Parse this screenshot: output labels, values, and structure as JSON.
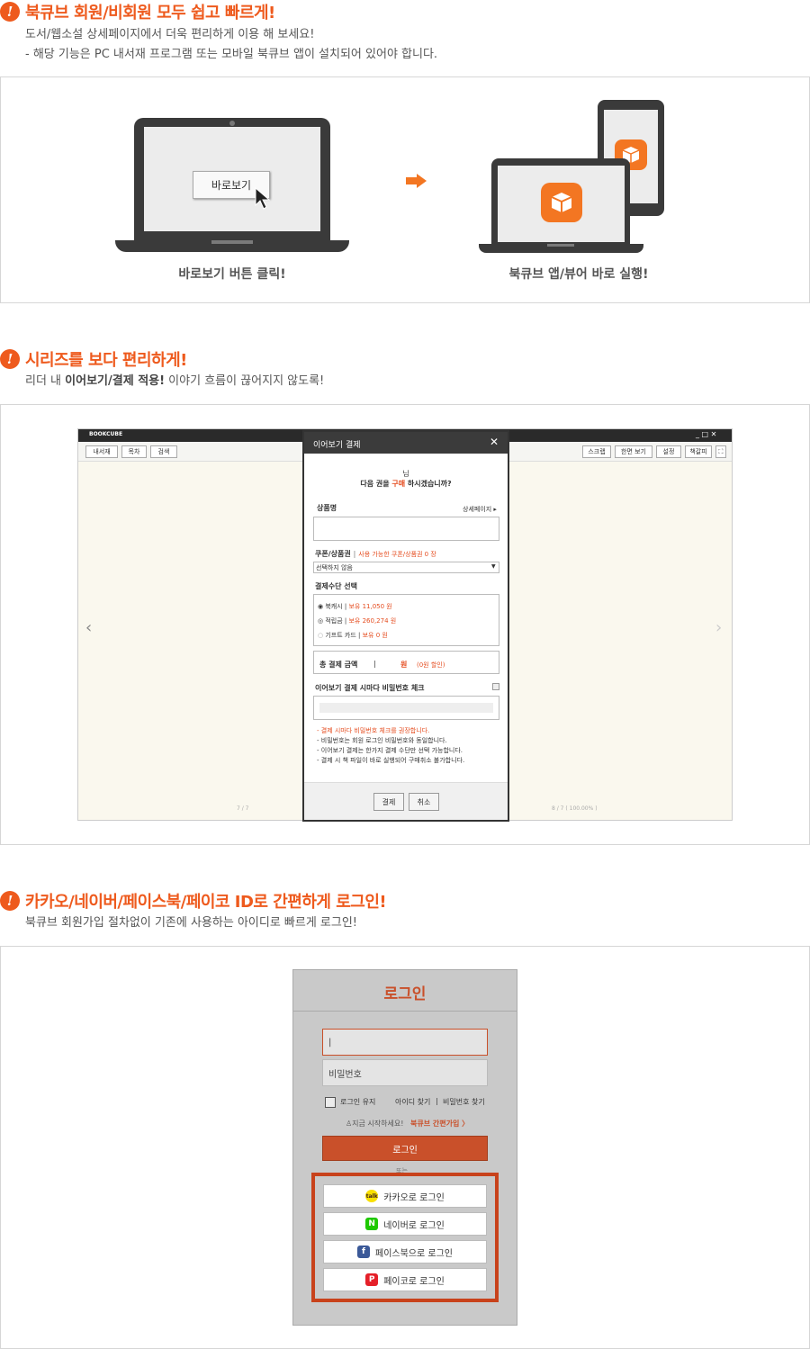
{
  "section1": {
    "title": "북큐브 회원/비회원 모두 쉽고 빠르게!",
    "desc1": "도서/웹소설 상세페이지에서 더욱 편리하게 이용 해 보세요!",
    "desc2": "- 해당 기능은 PC 내서재 프로그램 또는 모바일 북큐브 앱이 설치되어 있어야 합니다.",
    "button_label": "바로보기",
    "caption_left": "바로보기 버튼 클릭!",
    "caption_right": "북큐브 앱/뷰어 바로 실행!"
  },
  "section2": {
    "title": "시리즈를 보다 편리하게!",
    "desc_pre": "리더 내 ",
    "desc_bold": "이어보기/결제 적용!",
    "desc_post": " 이야기 흐름이 끊어지지 않도록!",
    "reader": {
      "logo": "BOOKCUBE",
      "win_controls": "_ □ ✕",
      "left_tools": [
        "내서재",
        "목차",
        "검색"
      ],
      "right_tools": [
        "스크랩",
        "한면 보기",
        "설정",
        "책갈피"
      ],
      "page_left": "7 / 7",
      "page_right": "8 / 7 ( 100.00% )"
    },
    "dialog": {
      "title": "이어보기 결제",
      "close": "✕",
      "line1": "님",
      "line2_pre": "다음 권을 ",
      "line2_red": "구매",
      "line2_post": " 하시겠습니까?",
      "product_label": "상품명",
      "detail_link": "상세페이지 ▸",
      "coupon_label": "쿠폰/상품권",
      "coupon_info": "사용 가능한 쿠폰/상품권 0 장",
      "coupon_select": "선택하지 않음",
      "pay_label": "결제수단 선택",
      "pay_options": [
        {
          "name": "북캐시",
          "info": "보유 11,050 원"
        },
        {
          "name": "적립금",
          "info": "보유 260,274 원"
        },
        {
          "name": "기프트 카드",
          "info": "보유 0 원"
        }
      ],
      "total_label": "총 결제 금액",
      "total_value": "원",
      "total_discount": "(0원 할인)",
      "pw_check_label": "이어보기 결제 시마다 비밀번호 체크",
      "notes": [
        "- 결제 시마다 비밀번호 체크를 권장합니다.",
        "- 비밀번호는 회원 로그인 비밀번호와 동일합니다.",
        "- 이어보기 결제는 한가지 결제 수단만 선택 가능합니다.",
        "- 결제 시 책 파일이 바로 실행되어 구매취소 불가합니다."
      ],
      "pay_button": "결제",
      "cancel_button": "취소"
    }
  },
  "section3": {
    "title": "카카오/네이버/페이스북/페이코 ID로 간편하게 로그인!",
    "desc": "북큐브 회원가입 절차없이 기존에 사용하는 아이디로 빠르게 로그인!",
    "login": {
      "title": "로그인",
      "id_value": "|",
      "pw_placeholder": "비밀번호",
      "keep_login": "로그인 유지",
      "find_id": "아이디 찾기",
      "find_pw": "비밀번호 찾기",
      "start_text": "지금 시작하세요!",
      "signup_link": "북큐브 간편가입 〉",
      "login_button": "로그인",
      "or_text": "또는",
      "social": [
        {
          "label": "카카오로 로그인",
          "icon": "kakao-icon",
          "color": "#f9e000",
          "glyph": "talk"
        },
        {
          "label": "네이버로 로그인",
          "icon": "naver-icon",
          "color": "#1ec800",
          "glyph": "N"
        },
        {
          "label": "페이스북으로 로그인",
          "icon": "facebook-icon",
          "color": "#3b5998",
          "glyph": "f"
        },
        {
          "label": "페이코로 로그인",
          "icon": "payco-icon",
          "color": "#e52029",
          "glyph": "P"
        }
      ]
    }
  },
  "colors": {
    "accent": "#ee5a1d",
    "login_button": "#c9502a",
    "highlight_border": "#c8421b"
  }
}
